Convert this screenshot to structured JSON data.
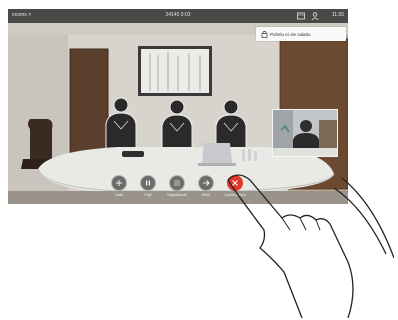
{
  "topbar": {
    "left_text": "ecoms >",
    "center_text": "24145  0:03",
    "right_text": "11:35"
  },
  "notice": {
    "text": "Puhelu ei ole salattu",
    "icon": "lock-icon"
  },
  "controls": [
    {
      "id": "add",
      "icon": "plus-icon",
      "label": "Lisää"
    },
    {
      "id": "hold",
      "icon": "pause-icon",
      "label": "Pidä"
    },
    {
      "id": "keypad",
      "icon": "keypad-icon",
      "label": "Näppäimistö"
    },
    {
      "id": "transfer",
      "icon": "arrow-right-icon",
      "label": "Siirrä"
    },
    {
      "id": "end",
      "icon": "close-icon",
      "label": "Lopeta puhelu"
    }
  ],
  "colors": {
    "end_call": "#e0392c",
    "topbar": "#141414",
    "notice_bg": "#fafafa"
  }
}
